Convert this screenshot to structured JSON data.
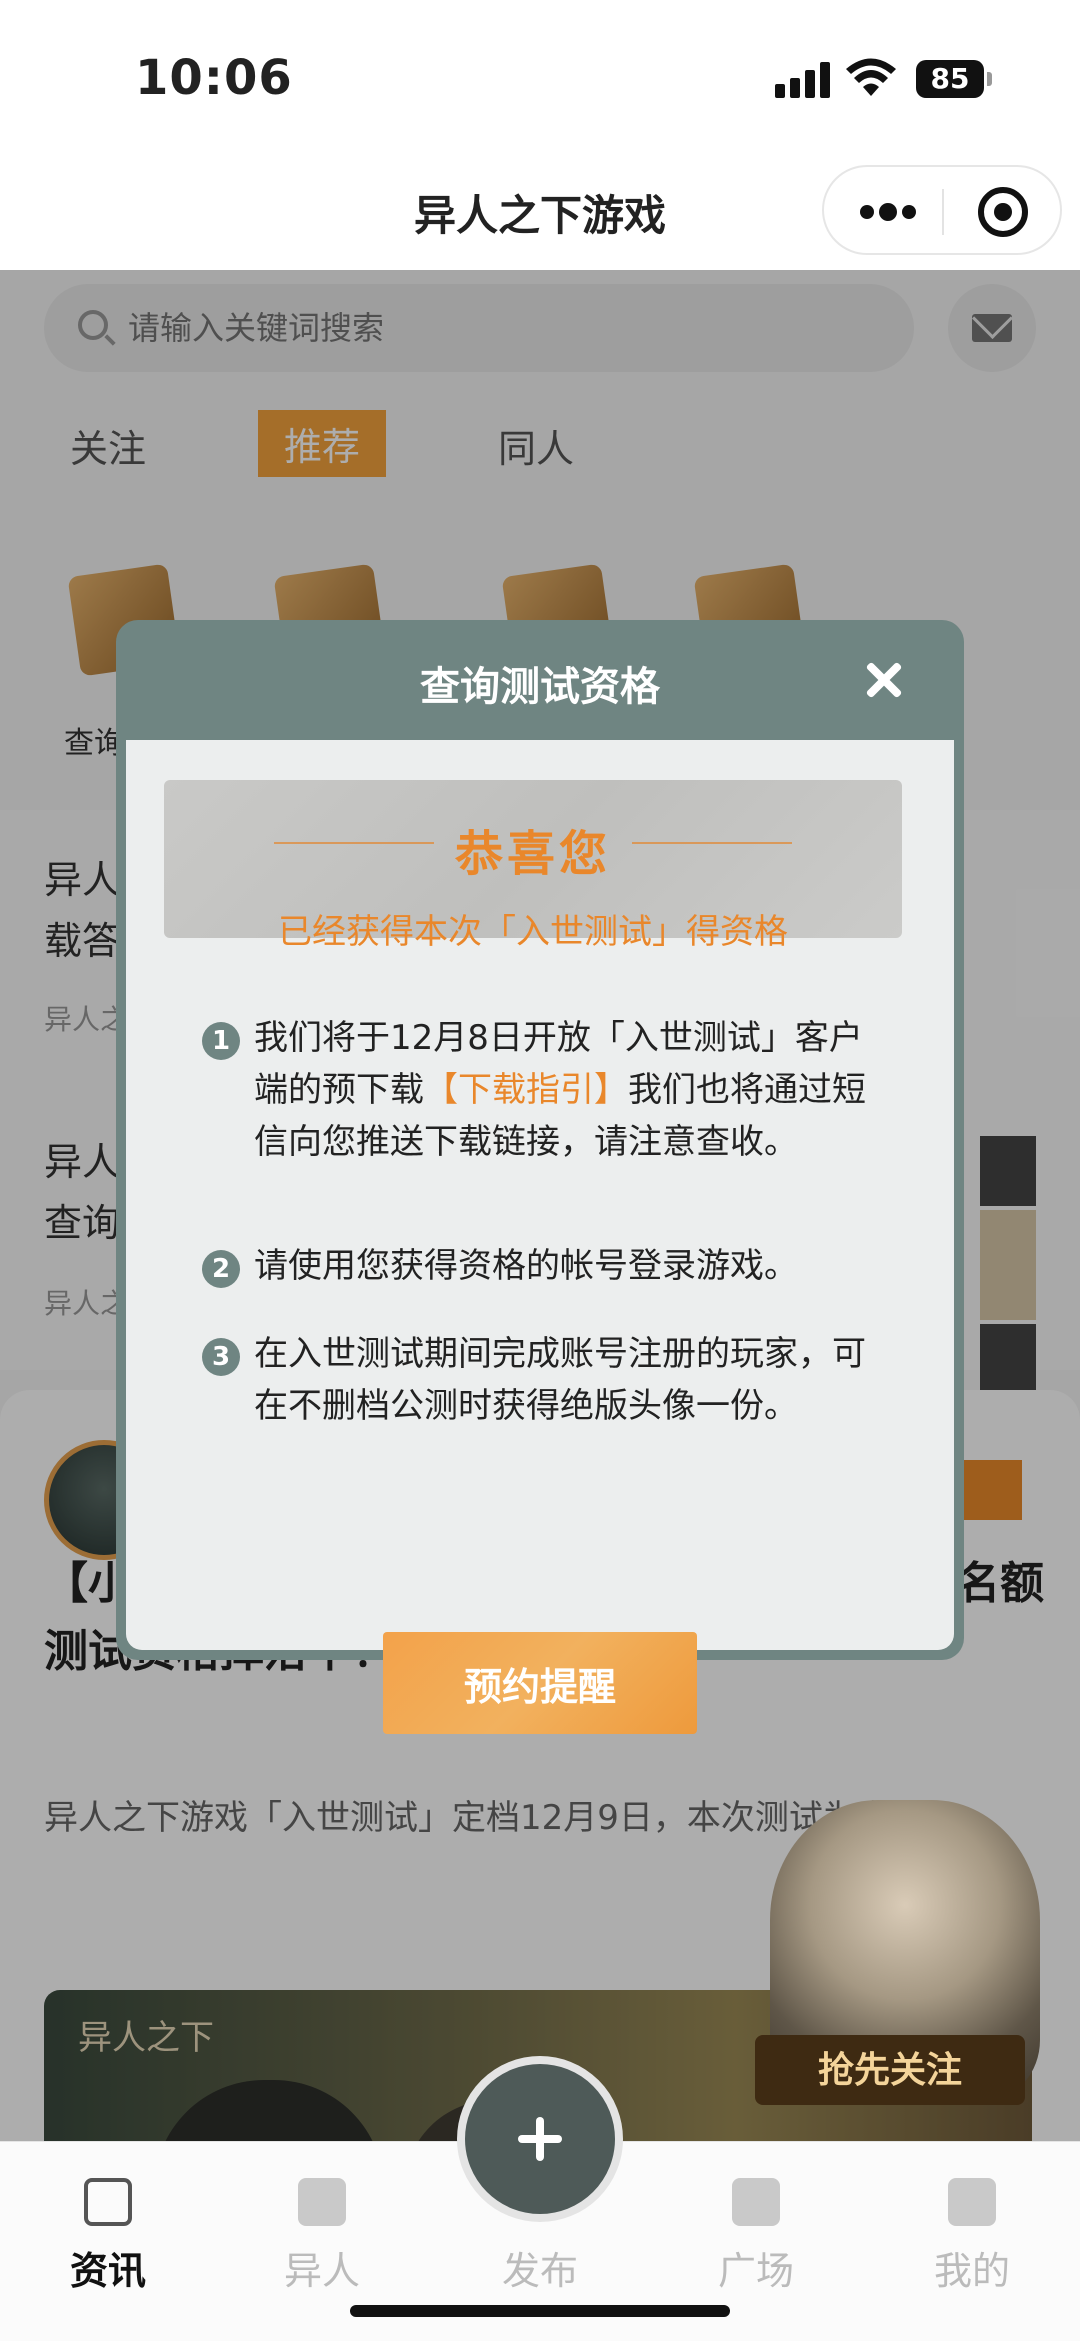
{
  "status_bar": {
    "time": "10:06",
    "battery": "85"
  },
  "navbar": {
    "title": "异人之下游戏"
  },
  "search": {
    "placeholder": "请输入关键词搜索"
  },
  "tabs": [
    {
      "label": "关注"
    },
    {
      "label": "推荐"
    },
    {
      "label": "同人"
    }
  ],
  "shortcuts": {
    "first_label": "查询"
  },
  "feed": [
    {
      "line1": "异人",
      "line2": "载答",
      "meta": "异人之"
    },
    {
      "line1": "异人",
      "line2": "查询",
      "meta": "异人之"
    }
  ],
  "article": {
    "title_line1": "【小",
    "title_suffix": "名额",
    "title_line2": "测试资格掉落中！",
    "excerpt": "异人之下游戏「入世测试」定档12月9日，本次测试为多端",
    "banner_logo": "异人之下",
    "badge": "抢先关注"
  },
  "modal": {
    "title": "查询测试资格",
    "congrats_title": "恭喜您",
    "congrats_sub": "已经获得本次「入世测试」得资格",
    "rules": [
      {
        "num": "1",
        "text_before": "我们将于12月8日开放「入世测试」客户端的预下载",
        "link": "【下载指引】",
        "text_after": "我们也将通过短信向您推送下载链接，请注意查收。"
      },
      {
        "num": "2",
        "text": "请使用您获得资格的帐号登录游戏。"
      },
      {
        "num": "3",
        "text": "在入世测试期间完成账号注册的玩家，可在不删档公测时获得绝版头像一份。"
      }
    ],
    "button": "预约提醒"
  },
  "tabbar": {
    "items": [
      {
        "label": "资讯",
        "icon": "news-icon"
      },
      {
        "label": "异人",
        "icon": "scroll-icon"
      },
      {
        "label": "发布",
        "icon": "plus-icon"
      },
      {
        "label": "广场",
        "icon": "chat-icon"
      },
      {
        "label": "我的",
        "icon": "user-icon"
      }
    ]
  },
  "colors": {
    "accent": "#f3a33d",
    "modal_header": "#6f8582",
    "highlight": "#e9872b"
  }
}
